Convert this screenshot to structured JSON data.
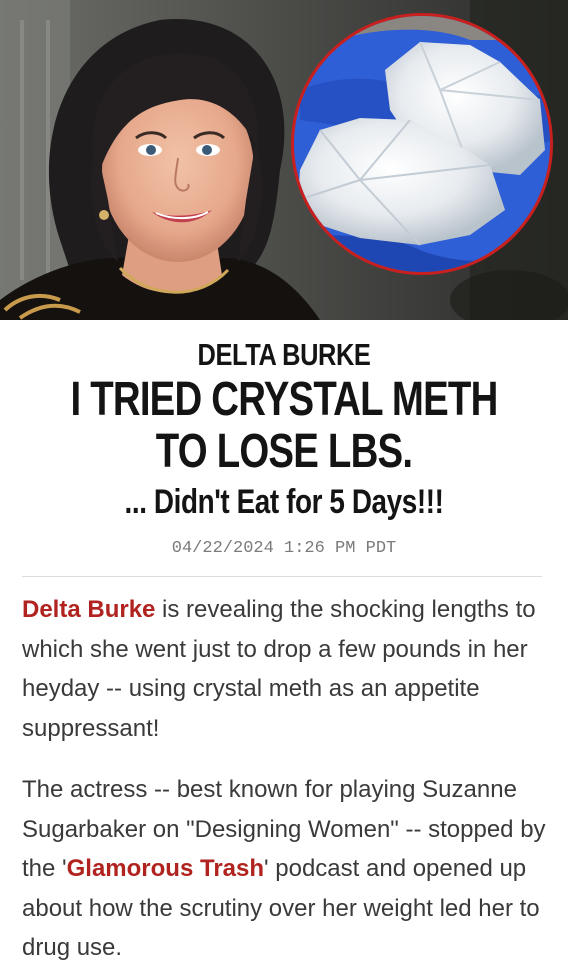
{
  "hero": {
    "left_image_alt": "Smiling woman with dark bob hairstyle",
    "right_image_alt": "Crystal shards held in blue gloved hands"
  },
  "article": {
    "kicker": "DELTA BURKE",
    "title_line1": "I TRIED CRYSTAL METH",
    "title_line2": "TO LOSE LBS.",
    "subtitle": "... Didn't Eat for 5 Days!!!",
    "timestamp": "04/22/2024 1:26 PM PDT",
    "p1_link": "Delta Burke",
    "p1_rest": " is revealing the shocking lengths to which she went just to drop a few pounds in her heyday -- using crystal meth as an appetite suppressant!",
    "p2_pre": "The actress -- best known for playing Suzanne Sugarbaker on \"Designing Women\" -- stopped by the '",
    "p2_link": "Glamorous Trash",
    "p2_post": "' podcast and opened up about how the scrutiny over her weight led her to drug use."
  },
  "colors": {
    "link": "#b0231f",
    "headline": "#141414",
    "body": "#3a3a3a",
    "timestamp": "#7a7a7a",
    "circle_border": "#c8201e",
    "glove": "#2f5fd6"
  }
}
